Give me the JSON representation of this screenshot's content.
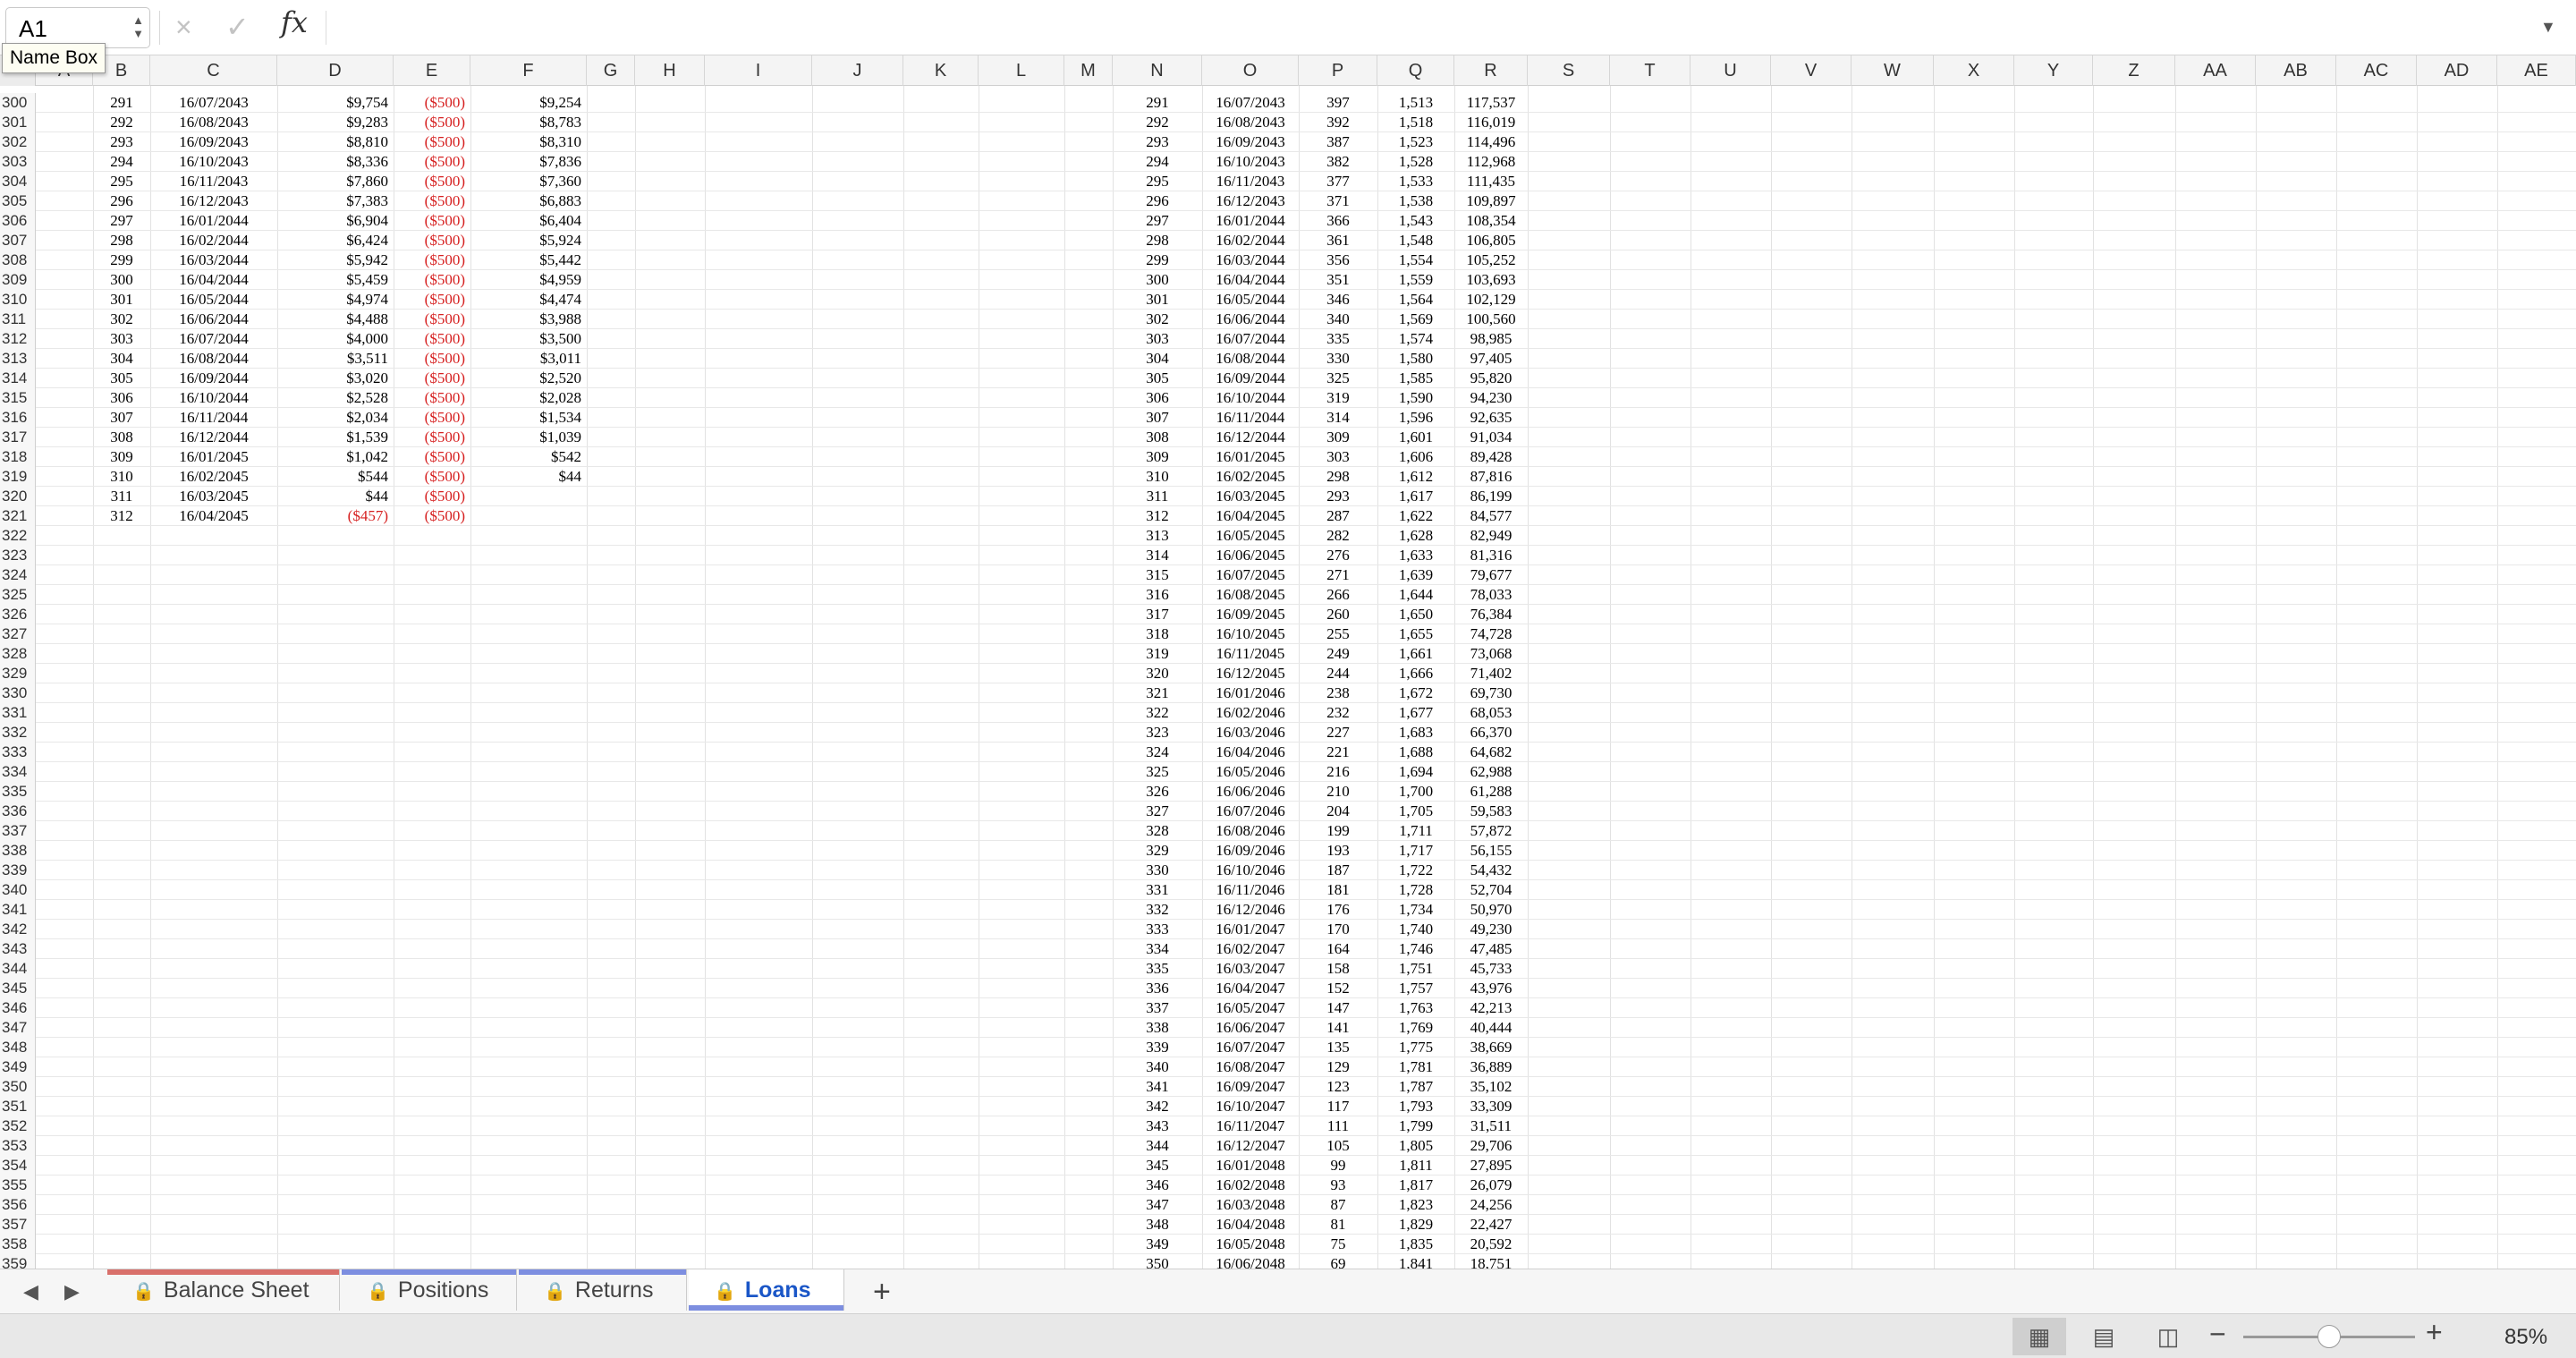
{
  "formula_bar": {
    "name_box": "A1",
    "name_box_tooltip": "Name Box",
    "fx_label": "fx",
    "cancel_icon": "×",
    "confirm_icon": "✓",
    "formula": ""
  },
  "columns": [
    "A",
    "B",
    "C",
    "D",
    "E",
    "F",
    "G",
    "H",
    "I",
    "J",
    "K",
    "L",
    "M",
    "N",
    "O",
    "P",
    "Q",
    "R",
    "S",
    "T",
    "U",
    "V",
    "W",
    "X",
    "Y",
    "Z",
    "AA",
    "AB",
    "AC",
    "AD",
    "AE"
  ],
  "rows": [
    [
      "300",
      "291",
      "16/07/2043",
      "$9,754",
      "($500)",
      "$9,254",
      "291",
      "16/07/2043",
      "397",
      "1,513",
      "117,537"
    ],
    [
      "301",
      "292",
      "16/08/2043",
      "$9,283",
      "($500)",
      "$8,783",
      "292",
      "16/08/2043",
      "392",
      "1,518",
      "116,019"
    ],
    [
      "302",
      "293",
      "16/09/2043",
      "$8,810",
      "($500)",
      "$8,310",
      "293",
      "16/09/2043",
      "387",
      "1,523",
      "114,496"
    ],
    [
      "303",
      "294",
      "16/10/2043",
      "$8,336",
      "($500)",
      "$7,836",
      "294",
      "16/10/2043",
      "382",
      "1,528",
      "112,968"
    ],
    [
      "304",
      "295",
      "16/11/2043",
      "$7,860",
      "($500)",
      "$7,360",
      "295",
      "16/11/2043",
      "377",
      "1,533",
      "111,435"
    ],
    [
      "305",
      "296",
      "16/12/2043",
      "$7,383",
      "($500)",
      "$6,883",
      "296",
      "16/12/2043",
      "371",
      "1,538",
      "109,897"
    ],
    [
      "306",
      "297",
      "16/01/2044",
      "$6,904",
      "($500)",
      "$6,404",
      "297",
      "16/01/2044",
      "366",
      "1,543",
      "108,354"
    ],
    [
      "307",
      "298",
      "16/02/2044",
      "$6,424",
      "($500)",
      "$5,924",
      "298",
      "16/02/2044",
      "361",
      "1,548",
      "106,805"
    ],
    [
      "308",
      "299",
      "16/03/2044",
      "$5,942",
      "($500)",
      "$5,442",
      "299",
      "16/03/2044",
      "356",
      "1,554",
      "105,252"
    ],
    [
      "309",
      "300",
      "16/04/2044",
      "$5,459",
      "($500)",
      "$4,959",
      "300",
      "16/04/2044",
      "351",
      "1,559",
      "103,693"
    ],
    [
      "310",
      "301",
      "16/05/2044",
      "$4,974",
      "($500)",
      "$4,474",
      "301",
      "16/05/2044",
      "346",
      "1,564",
      "102,129"
    ],
    [
      "311",
      "302",
      "16/06/2044",
      "$4,488",
      "($500)",
      "$3,988",
      "302",
      "16/06/2044",
      "340",
      "1,569",
      "100,560"
    ],
    [
      "312",
      "303",
      "16/07/2044",
      "$4,000",
      "($500)",
      "$3,500",
      "303",
      "16/07/2044",
      "335",
      "1,574",
      "98,985"
    ],
    [
      "313",
      "304",
      "16/08/2044",
      "$3,511",
      "($500)",
      "$3,011",
      "304",
      "16/08/2044",
      "330",
      "1,580",
      "97,405"
    ],
    [
      "314",
      "305",
      "16/09/2044",
      "$3,020",
      "($500)",
      "$2,520",
      "305",
      "16/09/2044",
      "325",
      "1,585",
      "95,820"
    ],
    [
      "315",
      "306",
      "16/10/2044",
      "$2,528",
      "($500)",
      "$2,028",
      "306",
      "16/10/2044",
      "319",
      "1,590",
      "94,230"
    ],
    [
      "316",
      "307",
      "16/11/2044",
      "$2,034",
      "($500)",
      "$1,534",
      "307",
      "16/11/2044",
      "314",
      "1,596",
      "92,635"
    ],
    [
      "317",
      "308",
      "16/12/2044",
      "$1,539",
      "($500)",
      "$1,039",
      "308",
      "16/12/2044",
      "309",
      "1,601",
      "91,034"
    ],
    [
      "318",
      "309",
      "16/01/2045",
      "$1,042",
      "($500)",
      "$542",
      "309",
      "16/01/2045",
      "303",
      "1,606",
      "89,428"
    ],
    [
      "319",
      "310",
      "16/02/2045",
      "$544",
      "($500)",
      "$44",
      "310",
      "16/02/2045",
      "298",
      "1,612",
      "87,816"
    ],
    [
      "320",
      "311",
      "16/03/2045",
      "$44",
      "($500)",
      "",
      "311",
      "16/03/2045",
      "293",
      "1,617",
      "86,199"
    ],
    [
      "321",
      "312",
      "16/04/2045",
      "($457)",
      "($500)",
      "",
      "312",
      "16/04/2045",
      "287",
      "1,622",
      "84,577"
    ],
    [
      "322",
      "",
      "",
      "",
      "",
      "",
      "313",
      "16/05/2045",
      "282",
      "1,628",
      "82,949"
    ],
    [
      "323",
      "",
      "",
      "",
      "",
      "",
      "314",
      "16/06/2045",
      "276",
      "1,633",
      "81,316"
    ],
    [
      "324",
      "",
      "",
      "",
      "",
      "",
      "315",
      "16/07/2045",
      "271",
      "1,639",
      "79,677"
    ],
    [
      "325",
      "",
      "",
      "",
      "",
      "",
      "316",
      "16/08/2045",
      "266",
      "1,644",
      "78,033"
    ],
    [
      "326",
      "",
      "",
      "",
      "",
      "",
      "317",
      "16/09/2045",
      "260",
      "1,650",
      "76,384"
    ],
    [
      "327",
      "",
      "",
      "",
      "",
      "",
      "318",
      "16/10/2045",
      "255",
      "1,655",
      "74,728"
    ],
    [
      "328",
      "",
      "",
      "",
      "",
      "",
      "319",
      "16/11/2045",
      "249",
      "1,661",
      "73,068"
    ],
    [
      "329",
      "",
      "",
      "",
      "",
      "",
      "320",
      "16/12/2045",
      "244",
      "1,666",
      "71,402"
    ],
    [
      "330",
      "",
      "",
      "",
      "",
      "",
      "321",
      "16/01/2046",
      "238",
      "1,672",
      "69,730"
    ],
    [
      "331",
      "",
      "",
      "",
      "",
      "",
      "322",
      "16/02/2046",
      "232",
      "1,677",
      "68,053"
    ],
    [
      "332",
      "",
      "",
      "",
      "",
      "",
      "323",
      "16/03/2046",
      "227",
      "1,683",
      "66,370"
    ],
    [
      "333",
      "",
      "",
      "",
      "",
      "",
      "324",
      "16/04/2046",
      "221",
      "1,688",
      "64,682"
    ],
    [
      "334",
      "",
      "",
      "",
      "",
      "",
      "325",
      "16/05/2046",
      "216",
      "1,694",
      "62,988"
    ],
    [
      "335",
      "",
      "",
      "",
      "",
      "",
      "326",
      "16/06/2046",
      "210",
      "1,700",
      "61,288"
    ],
    [
      "336",
      "",
      "",
      "",
      "",
      "",
      "327",
      "16/07/2046",
      "204",
      "1,705",
      "59,583"
    ],
    [
      "337",
      "",
      "",
      "",
      "",
      "",
      "328",
      "16/08/2046",
      "199",
      "1,711",
      "57,872"
    ],
    [
      "338",
      "",
      "",
      "",
      "",
      "",
      "329",
      "16/09/2046",
      "193",
      "1,717",
      "56,155"
    ],
    [
      "339",
      "",
      "",
      "",
      "",
      "",
      "330",
      "16/10/2046",
      "187",
      "1,722",
      "54,432"
    ],
    [
      "340",
      "",
      "",
      "",
      "",
      "",
      "331",
      "16/11/2046",
      "181",
      "1,728",
      "52,704"
    ],
    [
      "341",
      "",
      "",
      "",
      "",
      "",
      "332",
      "16/12/2046",
      "176",
      "1,734",
      "50,970"
    ],
    [
      "342",
      "",
      "",
      "",
      "",
      "",
      "333",
      "16/01/2047",
      "170",
      "1,740",
      "49,230"
    ],
    [
      "343",
      "",
      "",
      "",
      "",
      "",
      "334",
      "16/02/2047",
      "164",
      "1,746",
      "47,485"
    ],
    [
      "344",
      "",
      "",
      "",
      "",
      "",
      "335",
      "16/03/2047",
      "158",
      "1,751",
      "45,733"
    ],
    [
      "345",
      "",
      "",
      "",
      "",
      "",
      "336",
      "16/04/2047",
      "152",
      "1,757",
      "43,976"
    ],
    [
      "346",
      "",
      "",
      "",
      "",
      "",
      "337",
      "16/05/2047",
      "147",
      "1,763",
      "42,213"
    ],
    [
      "347",
      "",
      "",
      "",
      "",
      "",
      "338",
      "16/06/2047",
      "141",
      "1,769",
      "40,444"
    ],
    [
      "348",
      "",
      "",
      "",
      "",
      "",
      "339",
      "16/07/2047",
      "135",
      "1,775",
      "38,669"
    ],
    [
      "349",
      "",
      "",
      "",
      "",
      "",
      "340",
      "16/08/2047",
      "129",
      "1,781",
      "36,889"
    ],
    [
      "350",
      "",
      "",
      "",
      "",
      "",
      "341",
      "16/09/2047",
      "123",
      "1,787",
      "35,102"
    ],
    [
      "351",
      "",
      "",
      "",
      "",
      "",
      "342",
      "16/10/2047",
      "117",
      "1,793",
      "33,309"
    ],
    [
      "352",
      "",
      "",
      "",
      "",
      "",
      "343",
      "16/11/2047",
      "111",
      "1,799",
      "31,511"
    ],
    [
      "353",
      "",
      "",
      "",
      "",
      "",
      "344",
      "16/12/2047",
      "105",
      "1,805",
      "29,706"
    ],
    [
      "354",
      "",
      "",
      "",
      "",
      "",
      "345",
      "16/01/2048",
      "99",
      "1,811",
      "27,895"
    ],
    [
      "355",
      "",
      "",
      "",
      "",
      "",
      "346",
      "16/02/2048",
      "93",
      "1,817",
      "26,079"
    ],
    [
      "356",
      "",
      "",
      "",
      "",
      "",
      "347",
      "16/03/2048",
      "87",
      "1,823",
      "24,256"
    ],
    [
      "357",
      "",
      "",
      "",
      "",
      "",
      "348",
      "16/04/2048",
      "81",
      "1,829",
      "22,427"
    ],
    [
      "358",
      "",
      "",
      "",
      "",
      "",
      "349",
      "16/05/2048",
      "75",
      "1,835",
      "20,592"
    ],
    [
      "359",
      "",
      "",
      "",
      "",
      "",
      "350",
      "16/06/2048",
      "69",
      "1,841",
      "18,751"
    ]
  ],
  "tabs": [
    {
      "label": "Balance Sheet",
      "color": "#d9706b",
      "active": false
    },
    {
      "label": "Positions",
      "color": "#7d8ee0",
      "active": false
    },
    {
      "label": "Returns",
      "color": "#7d8ee0",
      "active": false
    },
    {
      "label": "Loans",
      "color": "#7d8ee0",
      "active": true
    }
  ],
  "add_sheet_label": "+",
  "status": {
    "zoom": "85%",
    "zoom_level": 0.5
  }
}
